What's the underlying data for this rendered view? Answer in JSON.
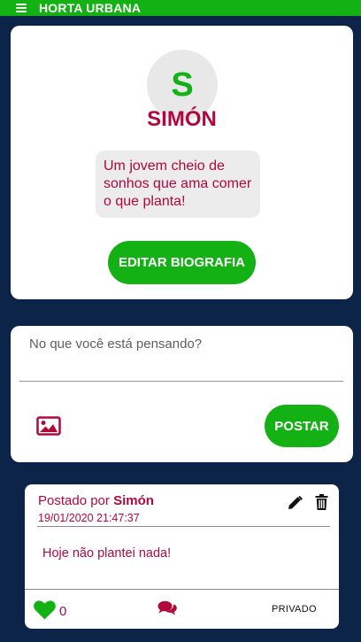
{
  "header": {
    "title": "HORTA URBANA",
    "menu_icon": "hamburger-menu-icon",
    "background": "#13b113"
  },
  "profile": {
    "avatar_letter": "S",
    "name": "SIMÓN",
    "bio": "Um jovem cheio de sonhos que ama comer o que planta!",
    "edit_button_label": "EDITAR BIOGRAFIA"
  },
  "composer": {
    "placeholder": "No que você está pensando?",
    "image_icon": "image-icon",
    "post_button_label": "POSTAR"
  },
  "post": {
    "posted_by_label": "Postado por",
    "author": "Simón",
    "date": "19/01/2020 21:47:37",
    "body": "Hoje não plantei nada!",
    "like_count": "0",
    "visibility": "PRIVADO",
    "icons": [
      "pencil-icon",
      "trash-icon",
      "heart-icon",
      "comments-icon"
    ]
  },
  "colors": {
    "accent_green": "#13b113",
    "text_crimson": "#b0093c",
    "page_background": "#0b2447"
  }
}
